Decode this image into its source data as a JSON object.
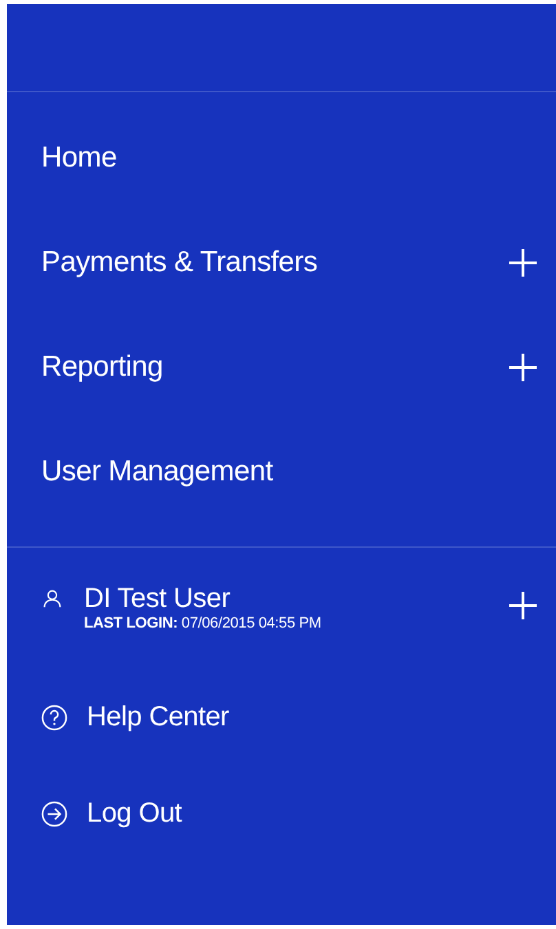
{
  "menu": [
    {
      "label": "Home",
      "kind": "link"
    },
    {
      "label": "Payments & Transfers",
      "kind": "expandable"
    },
    {
      "label": "Reporting",
      "kind": "expandable"
    },
    {
      "label": "User Management",
      "kind": "link"
    }
  ],
  "user": {
    "name": "DI Test User",
    "last_login": "**LAST LOGIN:** 07/06/2015 04:55 PM",
    "kind": "expandable"
  },
  "links": [
    {
      "label": "Help Center",
      "kind": "help"
    },
    {
      "label": "Log Out",
      "kind": "logout"
    }
  ]
}
